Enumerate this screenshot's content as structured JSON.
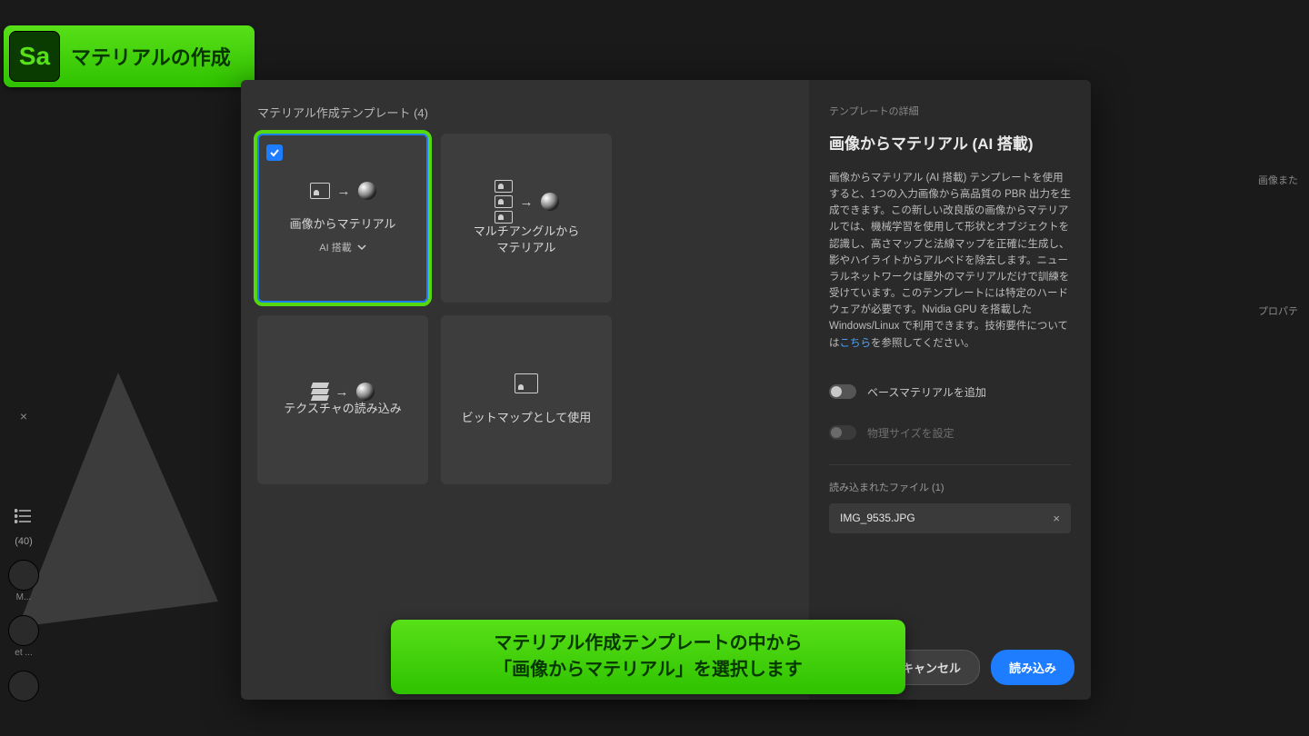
{
  "badgeTop": {
    "app": "Sa",
    "text": "マテリアルの作成"
  },
  "leftRail": {
    "count": "(40)",
    "m": "M...",
    "et": "et ..."
  },
  "rightRail": {
    "line1": "画像また",
    "line2": "プロパテ"
  },
  "dialog": {
    "header": "マテリアル作成テンプレート (4)",
    "cards": [
      {
        "title": "画像からマテリアル",
        "sub": "AI 搭載"
      },
      {
        "title": "マルチアングルから\nマテリアル"
      },
      {
        "title": "テクスチャの読み込み"
      },
      {
        "title": "ビットマップとして使用"
      }
    ],
    "details": {
      "hdr": "テンプレートの詳細",
      "title": "画像からマテリアル (AI 搭載)",
      "body": "画像からマテリアル (AI 搭載) テンプレートを使用すると、1つの入力画像から高品質の PBR 出力を生成できます。この新しい改良版の画像からマテリアルでは、機械学習を使用して形状とオブジェクトを認識し、高さマップと法線マップを正確に生成し、影やハイライトからアルベドを除去します。ニューラルネットワークは屋外のマテリアルだけで訓練を受けています。このテンプレートには特定のハードウェアが必要です。Nvidia GPU を搭載した Windows/Linux で利用できます。技術要件については",
      "link": "こちら",
      "body2": "を参照してください。",
      "toggle1": "ベースマテリアルを追加",
      "toggle2": "物理サイズを設定",
      "filesHdr": "読み込まれたファイル (1)",
      "file": "IMG_9535.JPG"
    },
    "footer": {
      "cancel": "キャンセル",
      "primary": "読み込み"
    }
  },
  "bannerBottom": "マテリアル作成テンプレートの中から\n「画像からマテリアル」を選択します"
}
